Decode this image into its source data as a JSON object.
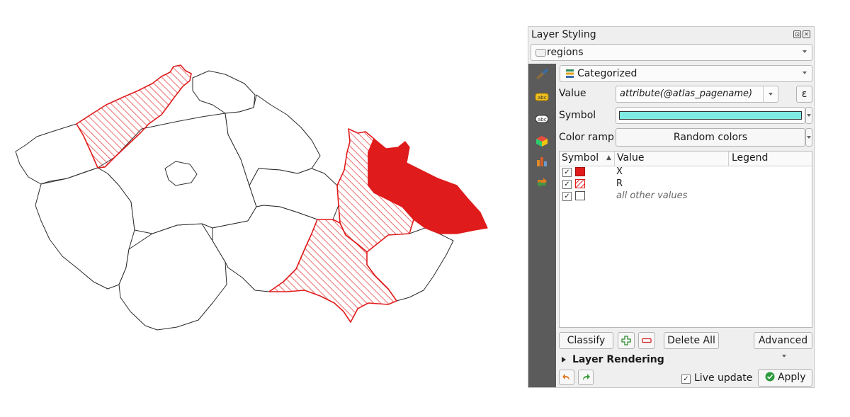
{
  "panel": {
    "title": "Layer Styling",
    "layer_name": "regions",
    "renderer": "Categorized",
    "value_label": "Value",
    "value_expression": "attribute(@atlas_pagename)",
    "expression_button": "ε",
    "symbol_label": "Symbol",
    "symbol_color": "#7fece4",
    "color_ramp_label": "Color ramp",
    "color_ramp_value": "Random colors",
    "table": {
      "headers": [
        "Symbol",
        "Value",
        "Legend"
      ],
      "sort_indicator": "▲",
      "rows": [
        {
          "checked": true,
          "symbol": "solid-red",
          "value": "X",
          "legend": ""
        },
        {
          "checked": true,
          "symbol": "hatched-red",
          "value": "R",
          "legend": ""
        },
        {
          "checked": true,
          "symbol": "empty",
          "value": "all other values",
          "legend": ""
        }
      ]
    },
    "classify_label": "Classify",
    "delete_all_label": "Delete All",
    "advanced_label": "Advanced",
    "layer_rendering_label": "Layer Rendering",
    "live_update_label": "Live update",
    "live_update_checked": true,
    "apply_label": "Apply"
  },
  "colors": {
    "highlight_fill": "#e01b1b",
    "hatch_stroke": "#e01b1b",
    "outline": "#2b2b2b",
    "sidebar": "#5b5b5b"
  },
  "icons": [
    "layer-icon",
    "paintbrush-icon",
    "labels-icon",
    "diagram-icon",
    "3d-icon",
    "masks-icon",
    "history-icon",
    "undo-icon",
    "redo-icon",
    "add-icon",
    "remove-icon",
    "apply-check-icon"
  ]
}
